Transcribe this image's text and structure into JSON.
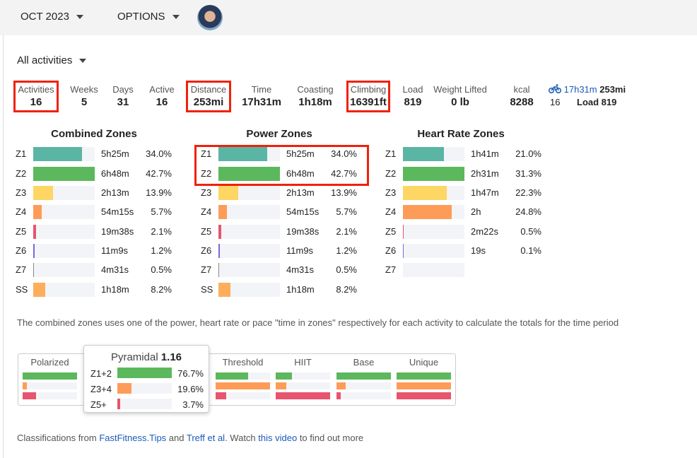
{
  "header": {
    "month": "OCT 2023",
    "options": "OPTIONS"
  },
  "filter": "All activities",
  "stats": [
    {
      "label": "Activities",
      "value": "16",
      "highlight": true
    },
    {
      "label": "Weeks",
      "value": "5"
    },
    {
      "label": "Days",
      "value": "31"
    },
    {
      "label": "Active",
      "value": "16"
    },
    {
      "label": "Distance",
      "value": "253mi",
      "highlight": true
    },
    {
      "label": "Time",
      "value": "17h31m"
    },
    {
      "label": "Coasting",
      "value": "1h18m"
    },
    {
      "label": "Climbing",
      "value": "16391ft",
      "highlight": true
    },
    {
      "label": "Load",
      "value": "819"
    },
    {
      "label": "Weight Lifted",
      "value": "0 lb"
    },
    {
      "label": "kcal",
      "value": "8288"
    }
  ],
  "ride": {
    "icon": "bicycle-icon",
    "time": "17h31m",
    "distance": "253mi",
    "count": "16",
    "load": "Load 819"
  },
  "zone_colors": {
    "Z1": "#5bb5a4",
    "Z2": "#5cb85c",
    "Z3": "#fdd663",
    "Z4": "#fd9c59",
    "Z5": "#e8546e",
    "Z6": "#7b68d8",
    "Z7": "#888888",
    "SS": "#fdae5c"
  },
  "zones": [
    {
      "title": "Combined Zones",
      "rows": [
        {
          "zone": "Z1",
          "time": "5h25m",
          "pct": "34.0%"
        },
        {
          "zone": "Z2",
          "time": "6h48m",
          "pct": "42.7%"
        },
        {
          "zone": "Z3",
          "time": "2h13m",
          "pct": "13.9%"
        },
        {
          "zone": "Z4",
          "time": "54m15s",
          "pct": "5.7%"
        },
        {
          "zone": "Z5",
          "time": "19m38s",
          "pct": "2.1%"
        },
        {
          "zone": "Z6",
          "time": "11m9s",
          "pct": "1.2%"
        },
        {
          "zone": "Z7",
          "time": "4m31s",
          "pct": "0.5%"
        },
        {
          "zone": "SS",
          "time": "1h18m",
          "pct": "8.2%"
        }
      ]
    },
    {
      "title": "Power Zones",
      "rows": [
        {
          "zone": "Z1",
          "time": "5h25m",
          "pct": "34.0%"
        },
        {
          "zone": "Z2",
          "time": "6h48m",
          "pct": "42.7%"
        },
        {
          "zone": "Z3",
          "time": "2h13m",
          "pct": "13.9%"
        },
        {
          "zone": "Z4",
          "time": "54m15s",
          "pct": "5.7%"
        },
        {
          "zone": "Z5",
          "time": "19m38s",
          "pct": "2.1%"
        },
        {
          "zone": "Z6",
          "time": "11m9s",
          "pct": "1.2%"
        },
        {
          "zone": "Z7",
          "time": "4m31s",
          "pct": "0.5%"
        },
        {
          "zone": "SS",
          "time": "1h18m",
          "pct": "8.2%"
        }
      ]
    },
    {
      "title": "Heart Rate Zones",
      "rows": [
        {
          "zone": "Z1",
          "time": "1h41m",
          "pct": "21.0%"
        },
        {
          "zone": "Z2",
          "time": "2h31m",
          "pct": "31.3%"
        },
        {
          "zone": "Z3",
          "time": "1h47m",
          "pct": "22.3%"
        },
        {
          "zone": "Z4",
          "time": "2h",
          "pct": "24.8%"
        },
        {
          "zone": "Z5",
          "time": "2m22s",
          "pct": "0.5%"
        },
        {
          "zone": "Z6",
          "time": "19s",
          "pct": "0.1%"
        },
        {
          "zone": "Z7",
          "time": "",
          "pct": ""
        }
      ]
    }
  ],
  "note": "The combined zones uses one of the power, heart rate or pace \"time in zones\" respectively for each activity to calculate the totals for the time period",
  "classifications": [
    {
      "name": "Polarized",
      "levels": [
        1,
        0.08,
        0.25
      ]
    },
    {
      "name": "Pyramidal",
      "levels": [
        1,
        0.26,
        0.05
      ]
    },
    {
      "name": "Threshold",
      "levels": [
        0.6,
        1,
        0.2
      ]
    },
    {
      "name": "HIIT",
      "levels": [
        0.3,
        0.2,
        1
      ]
    },
    {
      "name": "Base",
      "levels": [
        1,
        0.17,
        0.08
      ]
    },
    {
      "name": "Unique",
      "levels": [
        1,
        1,
        1
      ]
    }
  ],
  "class_colors": [
    "#5cb85c",
    "#fd9c59",
    "#e8546e"
  ],
  "popup": {
    "name": "Pyramidal",
    "score": "1.16",
    "rows": [
      {
        "label": "Z1+2",
        "pct": "76.7%",
        "level": 1
      },
      {
        "label": "Z3+4",
        "pct": "19.6%",
        "level": 0.26
      },
      {
        "label": "Z5+",
        "pct": "3.7%",
        "level": 0.05
      }
    ]
  },
  "footer": {
    "pre": "Classifications from ",
    "link1": "FastFitness.Tips",
    "mid1": " and ",
    "link2": "Treff et al",
    "mid2": ". Watch ",
    "link3": "this video",
    "post": " to find out more"
  }
}
